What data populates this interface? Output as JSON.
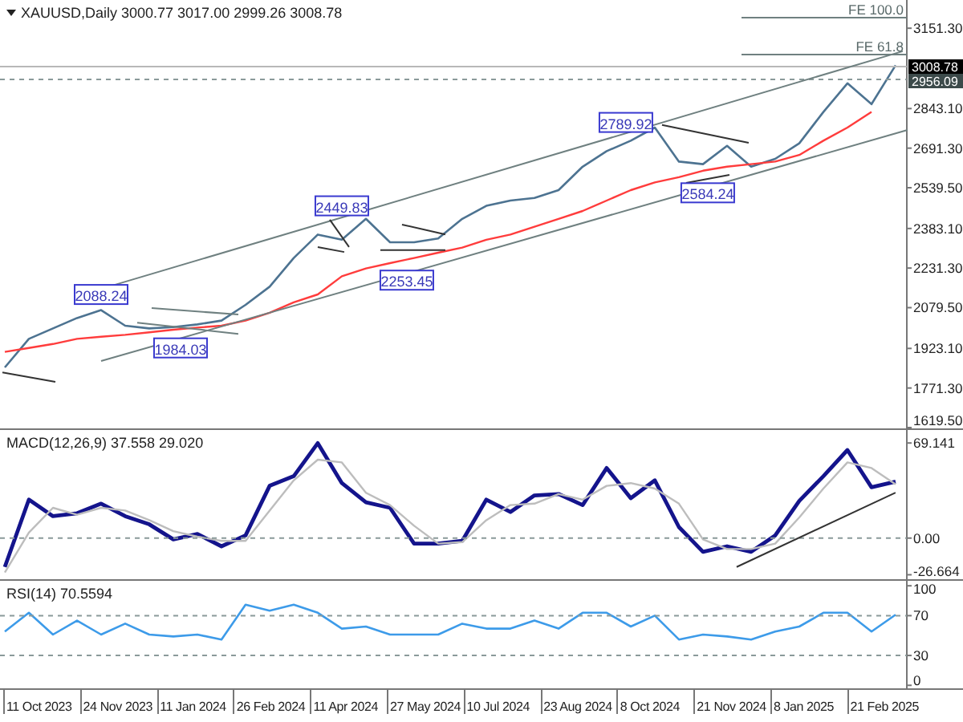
{
  "price_panel": {
    "chart_data": {
      "type": "line",
      "title": "XAUUSD,Daily 3000.77 3017.00 2999.26 3008.78",
      "categories": [
        null,
        null,
        null,
        null,
        null,
        null,
        null,
        null,
        null,
        null,
        null,
        null,
        null,
        null,
        null,
        null,
        null,
        null,
        null,
        null,
        null,
        null,
        null,
        null,
        null,
        null,
        null,
        null,
        null,
        null,
        null,
        null,
        null,
        null,
        null,
        null,
        null,
        null
      ],
      "ylim": [
        1616.4,
        3259.5
      ],
      "series": [
        {
          "color": "#4d7391",
          "values": [
            1850,
            1960,
            2000,
            2040,
            2070,
            2010,
            2000,
            2005,
            2015,
            2030,
            2090,
            2160,
            2270,
            2360,
            2340,
            2420,
            2330,
            2330,
            2345,
            2420,
            2470,
            2490,
            2500,
            2530,
            2620,
            2680,
            2720,
            2770,
            2640,
            2630,
            2700,
            2620,
            2650,
            2710,
            2830,
            2940,
            2860,
            3009
          ]
        },
        {
          "color": "#ff3c3c",
          "values": [
            1910,
            1925,
            1940,
            1960,
            1968,
            1975,
            1985,
            1995,
            2003,
            2010,
            2030,
            2060,
            2100,
            2130,
            2200,
            2230,
            2250,
            2270,
            2290,
            2310,
            2340,
            2360,
            2390,
            2420,
            2450,
            2490,
            2530,
            2560,
            2580,
            2605,
            2620,
            2630,
            2640,
            2665,
            2720,
            2770,
            2830,
            null
          ]
        }
      ],
      "yticks": [
        {
          "value": 3151.3,
          "label": "3151.30"
        },
        {
          "value": 2843.1,
          "label": "2843.10"
        },
        {
          "value": 2691.3,
          "label": "2691.30"
        },
        {
          "value": 2539.5,
          "label": "2539.50"
        },
        {
          "value": 2383.1,
          "label": "2383.10"
        },
        {
          "value": 2231.3,
          "label": "2231.30"
        },
        {
          "value": 2079.5,
          "label": "2079.50"
        },
        {
          "value": 1923.1,
          "label": "1923.10"
        },
        {
          "value": 1771.3,
          "label": "1771.30"
        },
        {
          "value": 1619.5,
          "label": "1619.50"
        }
      ],
      "annotations": [
        "2088.24",
        "1984.03",
        "2449.83",
        "2253.45",
        "2789.92",
        "2584.24"
      ]
    },
    "fe_levels": [
      {
        "text": "FE 100.0"
      },
      {
        "text": "FE 61.8"
      }
    ],
    "price_tags": [
      {
        "text": "3008.78",
        "kind": "last"
      },
      {
        "text": "2956.09",
        "kind": "level"
      }
    ]
  },
  "macd_panel": {
    "chart_data": {
      "type": "line",
      "title": "MACD(12,26,9) 37.558 29.020",
      "categories": [
        null,
        null,
        null,
        null,
        null,
        null,
        null,
        null,
        null,
        null,
        null,
        null,
        null,
        null,
        null,
        null,
        null,
        null,
        null,
        null,
        null,
        null,
        null,
        null,
        null,
        null,
        null,
        null,
        null,
        null,
        null,
        null,
        null,
        null,
        null,
        null,
        null,
        null
      ],
      "ylim": [
        -29.9,
        78.6
      ],
      "series": [
        {
          "color": "#14148c",
          "values": [
            -21,
            28,
            16,
            18,
            25,
            16,
            10,
            -1,
            3,
            -6,
            2,
            38,
            45,
            69,
            40,
            26,
            22,
            -4,
            -4,
            -2,
            28,
            19,
            31,
            32,
            24,
            51,
            29,
            42,
            8,
            -10,
            -6,
            -10,
            2,
            27,
            45,
            64,
            37,
            41
          ]
        },
        {
          "color": "#bdbdbd",
          "values": [
            -25,
            4,
            22,
            17,
            22,
            20,
            13,
            5,
            1,
            -2,
            -2,
            20,
            42,
            57,
            55,
            33,
            24,
            9,
            -4,
            -3,
            13,
            24,
            25,
            32,
            28,
            38,
            40,
            36,
            25,
            -1,
            -8,
            -8,
            -4,
            15,
            36,
            55,
            51,
            39
          ]
        }
      ],
      "yticks": [
        {
          "value": 69.141,
          "label": "69.141"
        },
        {
          "value": 0,
          "label": "0.00"
        },
        {
          "value": -26.664,
          "label": "-26.664"
        }
      ]
    }
  },
  "rsi_panel": {
    "chart_data": {
      "type": "line",
      "title": "RSI(14) 70.5594",
      "categories": [
        null,
        null,
        null,
        null,
        null,
        null,
        null,
        null,
        null,
        null,
        null,
        null,
        null,
        null,
        null,
        null,
        null,
        null,
        null,
        null,
        null,
        null,
        null,
        null,
        null,
        null,
        null,
        null,
        null,
        null,
        null,
        null,
        null,
        null,
        null,
        null,
        null,
        null
      ],
      "ylim": [
        -3,
        105
      ],
      "series": [
        {
          "color": "#3d9be9",
          "values": [
            54,
            73,
            51,
            65,
            51,
            62,
            51,
            49,
            51,
            46,
            81,
            75,
            81,
            73,
            57,
            59,
            51,
            51,
            51,
            62,
            57,
            57,
            65,
            57,
            73,
            73,
            59,
            70,
            46,
            51,
            49,
            46,
            54,
            59,
            73,
            73,
            54,
            71
          ]
        }
      ],
      "yticks": [
        {
          "value": 100,
          "label": "100"
        },
        {
          "value": 70,
          "label": "70"
        },
        {
          "value": 30,
          "label": "30"
        },
        {
          "value": 0,
          "label": "0"
        }
      ]
    }
  },
  "date_axis": [
    "11 Oct 2023",
    "24 Nov 2023",
    "11 Jan 2024",
    "26 Feb 2024",
    "11 Apr 2024",
    "27 May 2024",
    "10 Jul 2024",
    "23 Aug 2024",
    "8 Oct 2024",
    "21 Nov 2024",
    "8 Jan 2025",
    "21 Feb 2025"
  ]
}
